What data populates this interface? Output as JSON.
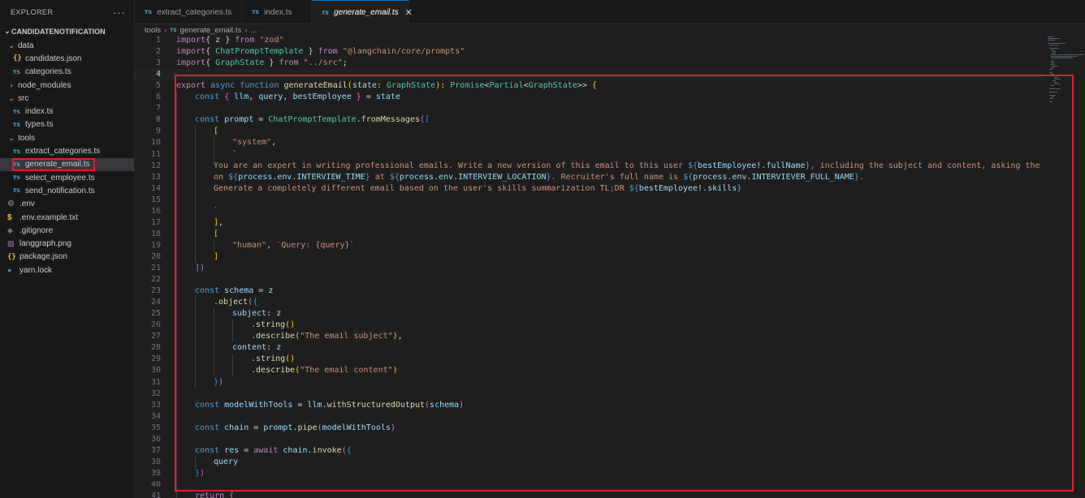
{
  "sidebar": {
    "title": "EXPLORER",
    "more_label": "···",
    "root": "CANDIDATENOTIFICATION",
    "items": [
      {
        "label": "data",
        "kind": "folder-open",
        "depth": 0,
        "icon": "chevron-down-icon"
      },
      {
        "label": "candidates.json",
        "kind": "json",
        "depth": 1,
        "icon": "json-file-icon"
      },
      {
        "label": "categories.ts",
        "kind": "ts",
        "depth": 1,
        "icon": "typescript-file-icon"
      },
      {
        "label": "node_modules",
        "kind": "folder-closed",
        "depth": 0,
        "icon": "chevron-right-icon"
      },
      {
        "label": "src",
        "kind": "folder-open",
        "depth": 0,
        "icon": "chevron-down-icon"
      },
      {
        "label": "index.ts",
        "kind": "ts",
        "depth": 1,
        "icon": "typescript-file-icon"
      },
      {
        "label": "types.ts",
        "kind": "ts",
        "depth": 1,
        "icon": "typescript-file-icon"
      },
      {
        "label": "tools",
        "kind": "folder-open",
        "depth": 0,
        "icon": "chevron-down-icon"
      },
      {
        "label": "extract_categories.ts",
        "kind": "ts",
        "depth": 1,
        "icon": "typescript-file-icon"
      },
      {
        "label": "generate_email.ts",
        "kind": "ts",
        "depth": 1,
        "icon": "typescript-file-icon",
        "selected": true
      },
      {
        "label": "select_employee.ts",
        "kind": "ts",
        "depth": 1,
        "icon": "typescript-file-icon"
      },
      {
        "label": "send_notification.ts",
        "kind": "ts",
        "depth": 1,
        "icon": "typescript-file-icon"
      },
      {
        "label": ".env",
        "kind": "gear",
        "depth": 0,
        "icon": "gear-icon"
      },
      {
        "label": ".env.example.txt",
        "kind": "dollar",
        "depth": 0,
        "icon": "dollar-icon"
      },
      {
        "label": ".gitignore",
        "kind": "diamond",
        "depth": 0,
        "icon": "git-icon"
      },
      {
        "label": "langgraph.png",
        "kind": "image",
        "depth": 0,
        "icon": "image-icon"
      },
      {
        "label": "package.json",
        "kind": "json",
        "depth": 0,
        "icon": "json-file-icon"
      },
      {
        "label": "yarn.lock",
        "kind": "yarn",
        "depth": 0,
        "icon": "yarn-icon"
      }
    ]
  },
  "tabs": [
    {
      "label": "extract_categories.ts",
      "badge": "TS",
      "active": false
    },
    {
      "label": "index.ts",
      "badge": "TS",
      "active": false
    },
    {
      "label": "generate_email.ts",
      "badge": "TS",
      "active": true,
      "close": "✕"
    }
  ],
  "breadcrumb": {
    "folder": "tools",
    "sep": "›",
    "badge": "TS",
    "file": "generate_email.ts",
    "tail": "..."
  },
  "editor": {
    "current_line": 4,
    "lines": [
      {
        "n": "1",
        "indent": 0,
        "tokens": [
          [
            "ctl",
            "import"
          ],
          [
            "",
            "{ "
          ],
          [
            "var",
            "z"
          ],
          [
            "",
            " } "
          ],
          [
            "ctl",
            "from"
          ],
          [
            "",
            " "
          ],
          [
            "str",
            "\"zod\""
          ]
        ]
      },
      {
        "n": "2",
        "indent": 0,
        "tokens": [
          [
            "ctl",
            "import"
          ],
          [
            "",
            "{ "
          ],
          [
            "type",
            "ChatPromptTemplate"
          ],
          [
            "",
            " } "
          ],
          [
            "ctl",
            "from"
          ],
          [
            "",
            " "
          ],
          [
            "str",
            "\"@langchain/core/prompts\""
          ]
        ]
      },
      {
        "n": "3",
        "indent": 0,
        "tokens": [
          [
            "ctl",
            "import"
          ],
          [
            "",
            "{ "
          ],
          [
            "type",
            "GraphState"
          ],
          [
            "",
            " } "
          ],
          [
            "ctl",
            "from"
          ],
          [
            "",
            " "
          ],
          [
            "str",
            "\"../src\""
          ],
          [
            "",
            ";"
          ]
        ]
      },
      {
        "n": "4",
        "indent": 0,
        "tokens": []
      },
      {
        "n": "5",
        "indent": 0,
        "tokens": [
          [
            "ctl",
            "export"
          ],
          [
            "",
            " "
          ],
          [
            "kw",
            "async"
          ],
          [
            "",
            " "
          ],
          [
            "kw",
            "function"
          ],
          [
            "",
            " "
          ],
          [
            "fn",
            "generateEmail"
          ],
          [
            "p1",
            "("
          ],
          [
            "var",
            "state"
          ],
          [
            "",
            ": "
          ],
          [
            "type",
            "GraphState"
          ],
          [
            "p1",
            ")"
          ],
          [
            "",
            ": "
          ],
          [
            "type",
            "Promise"
          ],
          [
            "",
            "<"
          ],
          [
            "type",
            "Partial"
          ],
          [
            "",
            "<"
          ],
          [
            "type",
            "GraphState"
          ],
          [
            "",
            ">> "
          ],
          [
            "p1",
            "{"
          ]
        ]
      },
      {
        "n": "6",
        "indent": 1,
        "tokens": [
          [
            "kw",
            "const"
          ],
          [
            "",
            " "
          ],
          [
            "p2",
            "{"
          ],
          [
            " ",
            ""
          ],
          [
            "var",
            " llm"
          ],
          [
            "",
            ", "
          ],
          [
            "var",
            "query"
          ],
          [
            "",
            ", "
          ],
          [
            "var",
            "bestEmployee"
          ],
          [
            "",
            " "
          ],
          [
            "p2",
            "}"
          ],
          [
            "",
            " = "
          ],
          [
            "var",
            "state"
          ]
        ]
      },
      {
        "n": "7",
        "indent": 1,
        "tokens": []
      },
      {
        "n": "8",
        "indent": 1,
        "tokens": [
          [
            "kw",
            "const"
          ],
          [
            "",
            " "
          ],
          [
            "var",
            "prompt"
          ],
          [
            "",
            " = "
          ],
          [
            "type",
            "ChatPromptTemplate"
          ],
          [
            "",
            "."
          ],
          [
            "fn",
            "fromMessages"
          ],
          [
            "p2",
            "("
          ],
          [
            "p3",
            "["
          ]
        ]
      },
      {
        "n": "9",
        "indent": 2,
        "tokens": [
          [
            "p1",
            "["
          ]
        ]
      },
      {
        "n": "10",
        "indent": 3,
        "tokens": [
          [
            "str",
            "\"system\""
          ],
          [
            "",
            ","
          ]
        ]
      },
      {
        "n": "11",
        "indent": 3,
        "tokens": [
          [
            "str",
            "`"
          ]
        ]
      },
      {
        "n": "12",
        "indent": 2,
        "tokens": [
          [
            "str",
            "You are an expert in writing professional emails. Write a new version of this email to this user "
          ],
          [
            "kw",
            "${"
          ],
          [
            "var",
            "bestEmployee"
          ],
          [
            "",
            "!."
          ],
          [
            "var",
            "fullName"
          ],
          [
            "kw",
            "}"
          ],
          [
            "str",
            ", including the subject and content, asking the given cand"
          ]
        ]
      },
      {
        "n": "13",
        "indent": 2,
        "tokens": [
          [
            "str",
            "on "
          ],
          [
            "kw",
            "${"
          ],
          [
            "var",
            "process"
          ],
          [
            "",
            "."
          ],
          [
            "var",
            "env"
          ],
          [
            "",
            "."
          ],
          [
            "var",
            "INTERVIEW_TIME"
          ],
          [
            "kw",
            "}"
          ],
          [
            "str",
            " at "
          ],
          [
            "kw",
            "${"
          ],
          [
            "var",
            "process"
          ],
          [
            "",
            "."
          ],
          [
            "var",
            "env"
          ],
          [
            "",
            "."
          ],
          [
            "var",
            "INTERVIEW_LOCATION"
          ],
          [
            "kw",
            "}"
          ],
          [
            "str",
            ". Recruiter's full name is "
          ],
          [
            "kw",
            "${"
          ],
          [
            "var",
            "process"
          ],
          [
            "",
            "."
          ],
          [
            "var",
            "env"
          ],
          [
            "",
            "."
          ],
          [
            "var",
            "INTERVIEVER_FULL_NAME"
          ],
          [
            "kw",
            "}"
          ],
          [
            "str",
            "."
          ]
        ]
      },
      {
        "n": "14",
        "indent": 2,
        "tokens": [
          [
            "str",
            "Generate a completely different email based on the user's skills summarization TL;DR "
          ],
          [
            "kw",
            "${"
          ],
          [
            "var",
            "bestEmployee"
          ],
          [
            "",
            "!."
          ],
          [
            "var",
            "skills"
          ],
          [
            "kw",
            "}"
          ]
        ]
      },
      {
        "n": "15",
        "indent": 2,
        "tokens": []
      },
      {
        "n": "16",
        "indent": 2,
        "tokens": [
          [
            "str",
            "`"
          ]
        ]
      },
      {
        "n": "17",
        "indent": 2,
        "tokens": [
          [
            "p1",
            "]"
          ],
          [
            "",
            ","
          ]
        ]
      },
      {
        "n": "18",
        "indent": 2,
        "tokens": [
          [
            "p1",
            "["
          ]
        ]
      },
      {
        "n": "19",
        "indent": 3,
        "tokens": [
          [
            "str",
            "\"human\""
          ],
          [
            "",
            ", "
          ],
          [
            "str",
            "`Query: {query}`"
          ]
        ]
      },
      {
        "n": "20",
        "indent": 2,
        "tokens": [
          [
            "p1",
            "]"
          ]
        ]
      },
      {
        "n": "21",
        "indent": 1,
        "tokens": [
          [
            "p3",
            "]"
          ],
          [
            "p2",
            ")"
          ]
        ]
      },
      {
        "n": "22",
        "indent": 1,
        "tokens": []
      },
      {
        "n": "23",
        "indent": 1,
        "tokens": [
          [
            "kw",
            "const"
          ],
          [
            "",
            " "
          ],
          [
            "var",
            "schema"
          ],
          [
            "",
            " = "
          ],
          [
            "var",
            "z"
          ]
        ]
      },
      {
        "n": "24",
        "indent": 2,
        "tokens": [
          [
            "",
            "."
          ],
          [
            "fn",
            "object"
          ],
          [
            "p2",
            "("
          ],
          [
            "p3",
            "{"
          ]
        ]
      },
      {
        "n": "25",
        "indent": 3,
        "tokens": [
          [
            "var",
            "subject"
          ],
          [
            "",
            ": "
          ],
          [
            "var",
            "z"
          ]
        ]
      },
      {
        "n": "26",
        "indent": 4,
        "tokens": [
          [
            "",
            "."
          ],
          [
            "fn",
            "string"
          ],
          [
            "p1",
            "()"
          ]
        ]
      },
      {
        "n": "27",
        "indent": 4,
        "tokens": [
          [
            "",
            "."
          ],
          [
            "fn",
            "describe"
          ],
          [
            "p1",
            "("
          ],
          [
            "str",
            "\"The email subject\""
          ],
          [
            "p1",
            ")"
          ],
          [
            "",
            ","
          ]
        ]
      },
      {
        "n": "28",
        "indent": 3,
        "tokens": [
          [
            "var",
            "content"
          ],
          [
            "",
            ": "
          ],
          [
            "var",
            "z"
          ]
        ]
      },
      {
        "n": "29",
        "indent": 4,
        "tokens": [
          [
            "",
            "."
          ],
          [
            "fn",
            "string"
          ],
          [
            "p1",
            "()"
          ]
        ]
      },
      {
        "n": "30",
        "indent": 4,
        "tokens": [
          [
            "",
            "."
          ],
          [
            "fn",
            "describe"
          ],
          [
            "p1",
            "("
          ],
          [
            "str",
            "\"The email content\""
          ],
          [
            "p1",
            ")"
          ]
        ]
      },
      {
        "n": "31",
        "indent": 2,
        "tokens": [
          [
            "p3",
            "}"
          ],
          [
            "p2",
            ")"
          ]
        ]
      },
      {
        "n": "32",
        "indent": 1,
        "tokens": []
      },
      {
        "n": "33",
        "indent": 1,
        "tokens": [
          [
            "kw",
            "const"
          ],
          [
            "",
            " "
          ],
          [
            "var",
            "modelWithTools"
          ],
          [
            "",
            " = "
          ],
          [
            "var",
            "llm"
          ],
          [
            "",
            "."
          ],
          [
            "fn",
            "withStructuredOutput"
          ],
          [
            "p2",
            "("
          ],
          [
            "var",
            "schema"
          ],
          [
            "p2",
            ")"
          ]
        ]
      },
      {
        "n": "34",
        "indent": 1,
        "tokens": []
      },
      {
        "n": "35",
        "indent": 1,
        "tokens": [
          [
            "kw",
            "const"
          ],
          [
            "",
            " "
          ],
          [
            "var",
            "chain"
          ],
          [
            "",
            " = "
          ],
          [
            "var",
            "prompt"
          ],
          [
            "",
            "."
          ],
          [
            "fn",
            "pipe"
          ],
          [
            "p2",
            "("
          ],
          [
            "var",
            "modelWithTools"
          ],
          [
            "p2",
            ")"
          ]
        ]
      },
      {
        "n": "36",
        "indent": 1,
        "tokens": []
      },
      {
        "n": "37",
        "indent": 1,
        "tokens": [
          [
            "kw",
            "const"
          ],
          [
            "",
            " "
          ],
          [
            "var",
            "res"
          ],
          [
            "",
            " = "
          ],
          [
            "ctl",
            "await"
          ],
          [
            "",
            " "
          ],
          [
            "var",
            "chain"
          ],
          [
            "",
            "."
          ],
          [
            "fn",
            "invoke"
          ],
          [
            "p2",
            "("
          ],
          [
            "p3",
            "{"
          ]
        ]
      },
      {
        "n": "38",
        "indent": 2,
        "tokens": [
          [
            "var",
            "query"
          ]
        ]
      },
      {
        "n": "39",
        "indent": 1,
        "tokens": [
          [
            "p3",
            "}"
          ],
          [
            "p2",
            ")"
          ]
        ]
      },
      {
        "n": "40",
        "indent": 1,
        "tokens": []
      },
      {
        "n": "41",
        "indent": 1,
        "tokens": [
          [
            "ctl",
            "return"
          ],
          [
            "",
            " "
          ],
          [
            "p2",
            "{"
          ]
        ]
      }
    ]
  },
  "colors": {
    "highlight_border": "#e0202a",
    "background": "#1e1e1e",
    "sidebar_bg": "#181818"
  }
}
